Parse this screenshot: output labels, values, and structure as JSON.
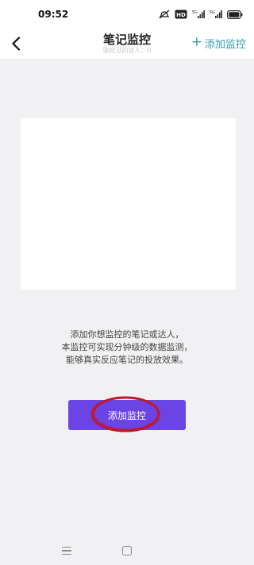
{
  "status_bar": {
    "time": "09:52",
    "icons": [
      "alarm-off-icon",
      "hd-icon",
      "signal-5g-icon",
      "signal-5g-icon",
      "battery-icon"
    ],
    "hd_label": "HD",
    "net_label_1": "5G",
    "net_label_2": "5G"
  },
  "header": {
    "title": "笔记监控",
    "subtitle": "监控过的达人：0",
    "add_link": "添加监控",
    "add_icon": "+"
  },
  "main": {
    "description": [
      "添加你想监控的笔记或达人，",
      "本监控可实现分钟级的数据监测，",
      "能够真实反应笔记的投放效果。"
    ],
    "button_label": "添加监控",
    "annotation_color": "#c0182a"
  },
  "colors": {
    "accent": "#6b44e6",
    "link": "#2e9eb0",
    "background": "#f1f1f3"
  }
}
